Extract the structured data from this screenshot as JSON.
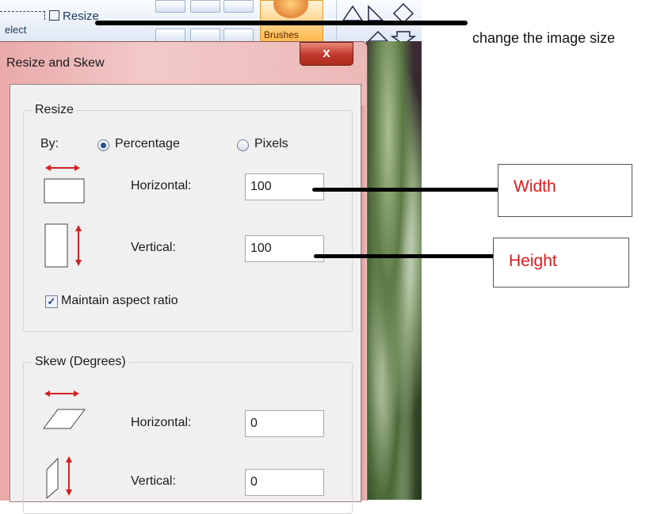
{
  "ribbon": {
    "resize_label": "Resize",
    "select_label": "elect",
    "brushes_label": "Brushes"
  },
  "dialog": {
    "title": "Resize and Skew",
    "close_label": "x",
    "resize": {
      "group_label": "Resize",
      "by_label": "By:",
      "option_percentage": "Percentage",
      "option_pixels": "Pixels",
      "selected": "Percentage",
      "horizontal_label": "Horizontal:",
      "horizontal_value": "100",
      "vertical_label": "Vertical:",
      "vertical_value": "100",
      "maintain_label": "Maintain aspect ratio",
      "maintain_checked": true
    },
    "skew": {
      "group_label": "Skew (Degrees)",
      "horizontal_label": "Horizontal:",
      "horizontal_value": "0",
      "vertical_label": "Vertical:",
      "vertical_value": "0"
    }
  },
  "annotations": {
    "top_note": "change the image size",
    "width_label": "Width",
    "height_label": "Height",
    "accent_color": "#e0191b"
  }
}
